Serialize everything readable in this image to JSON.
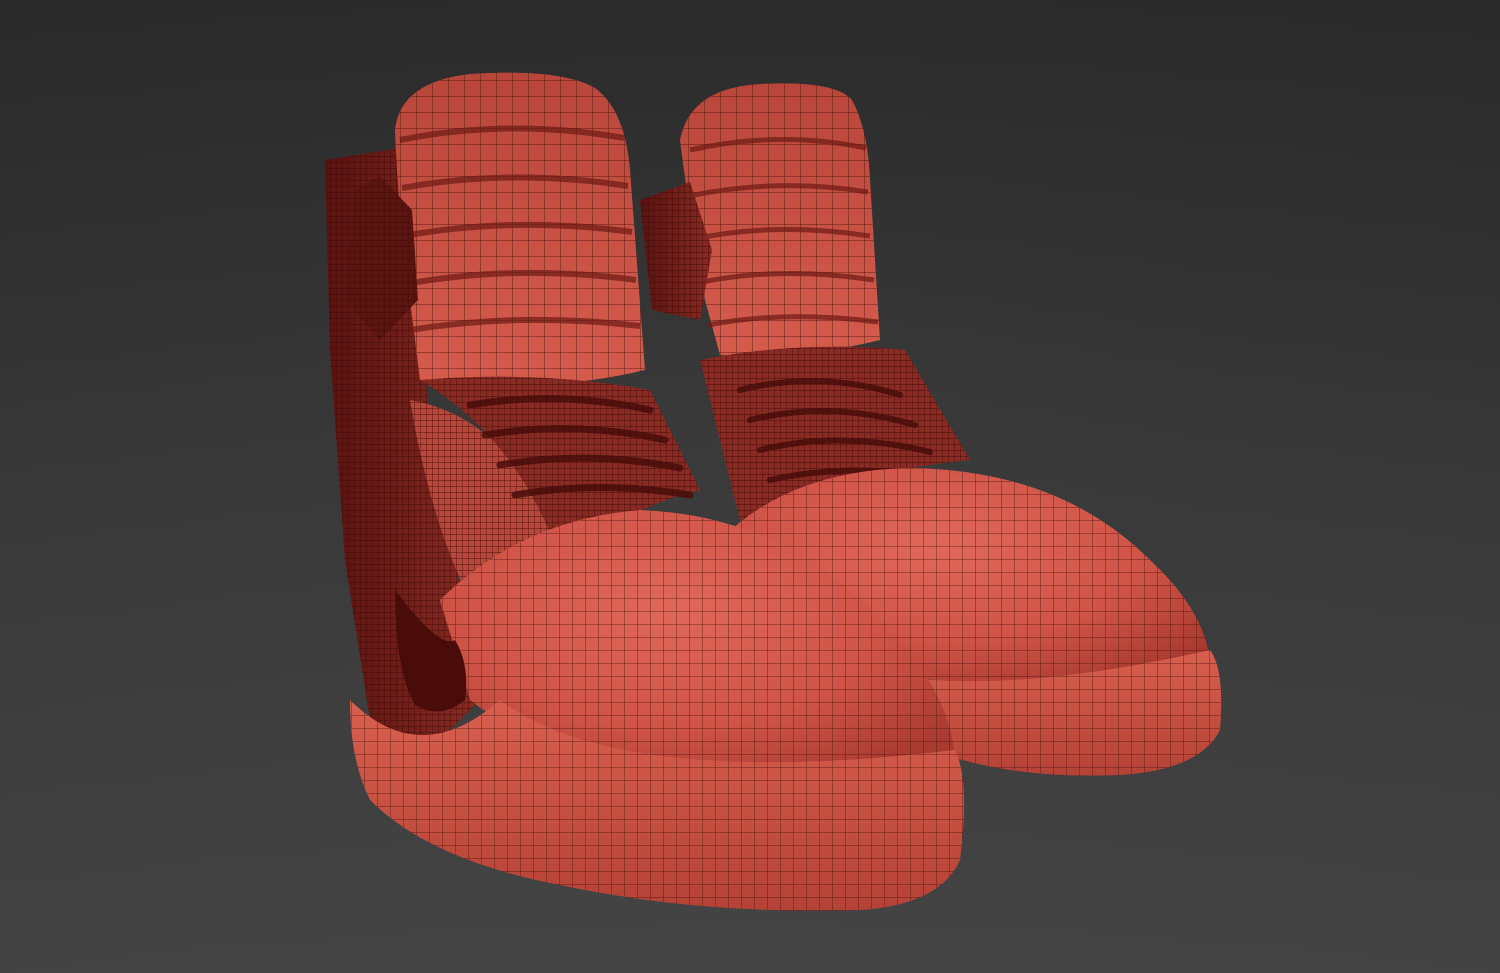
{
  "scene": {
    "background_color": "#3a3a3a",
    "mesh_color": "#d0574a",
    "wire_color": "#5a1410",
    "shadow_color": "#7a2018",
    "objects": [
      "left-sneaker",
      "right-sneaker"
    ]
  }
}
